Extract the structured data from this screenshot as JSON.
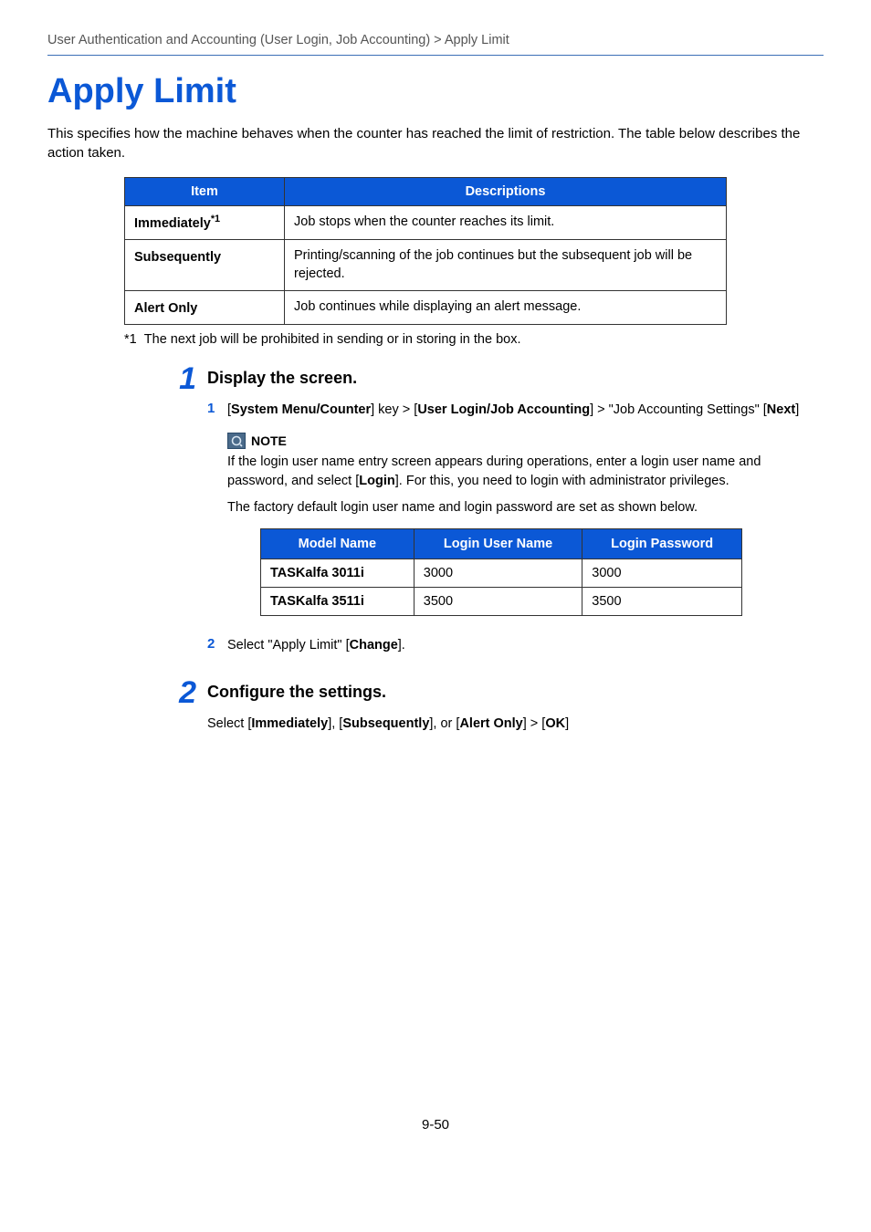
{
  "breadcrumb": "User Authentication and Accounting (User Login, Job Accounting) > Apply Limit",
  "title": "Apply Limit",
  "intro": "This specifies how the machine behaves when the counter has reached the limit of restriction. The table below describes the action taken.",
  "desc_table": {
    "headers": [
      "Item",
      "Descriptions"
    ],
    "rows": [
      {
        "item": "Immediately",
        "sup": "*1",
        "desc": "Job stops when the counter reaches its limit."
      },
      {
        "item": "Subsequently",
        "sup": "",
        "desc": "Printing/scanning of the job continues but the subsequent job will be rejected."
      },
      {
        "item": "Alert Only",
        "sup": "",
        "desc": "Job continues while displaying an alert message."
      }
    ]
  },
  "footnote_label": "*1",
  "footnote_text": "The next job will be prohibited in sending or in storing in the box.",
  "steps": [
    {
      "num": "1",
      "heading": "Display the screen.",
      "substeps": [
        {
          "num": "1",
          "parts": [
            {
              "t": "[",
              "b": false
            },
            {
              "t": "System Menu/Counter",
              "b": true
            },
            {
              "t": "] key > [",
              "b": false
            },
            {
              "t": "User Login/Job Accounting",
              "b": true
            },
            {
              "t": "] > \"Job Accounting Settings\" [",
              "b": false
            },
            {
              "t": "Next",
              "b": true
            },
            {
              "t": "]",
              "b": false
            }
          ]
        },
        {
          "num": "2",
          "parts": [
            {
              "t": "Select \"Apply Limit\" [",
              "b": false
            },
            {
              "t": "Change",
              "b": true
            },
            {
              "t": "].",
              "b": false
            }
          ]
        }
      ],
      "note": {
        "label": "NOTE",
        "lines": [
          [
            {
              "t": "If the login user name entry screen appears during operations, enter a login user name and password, and select [",
              "b": false
            },
            {
              "t": "Login",
              "b": true
            },
            {
              "t": "]. For this, you need to login with administrator privileges.",
              "b": false
            }
          ],
          [
            {
              "t": "The factory default login user name and login password are set as shown below.",
              "b": false
            }
          ]
        ],
        "login_table": {
          "headers": [
            "Model Name",
            "Login User Name",
            "Login Password"
          ],
          "rows": [
            [
              "TASKalfa 3011i",
              "3000",
              "3000"
            ],
            [
              "TASKalfa 3511i",
              "3500",
              "3500"
            ]
          ]
        }
      }
    },
    {
      "num": "2",
      "heading": "Configure the settings.",
      "body_parts": [
        {
          "t": "Select [",
          "b": false
        },
        {
          "t": "Immediately",
          "b": true
        },
        {
          "t": "], [",
          "b": false
        },
        {
          "t": "Subsequently",
          "b": true
        },
        {
          "t": "], or [",
          "b": false
        },
        {
          "t": "Alert Only",
          "b": true
        },
        {
          "t": "] > [",
          "b": false
        },
        {
          "t": "OK",
          "b": true
        },
        {
          "t": "]",
          "b": false
        }
      ]
    }
  ],
  "page_number": "9-50"
}
